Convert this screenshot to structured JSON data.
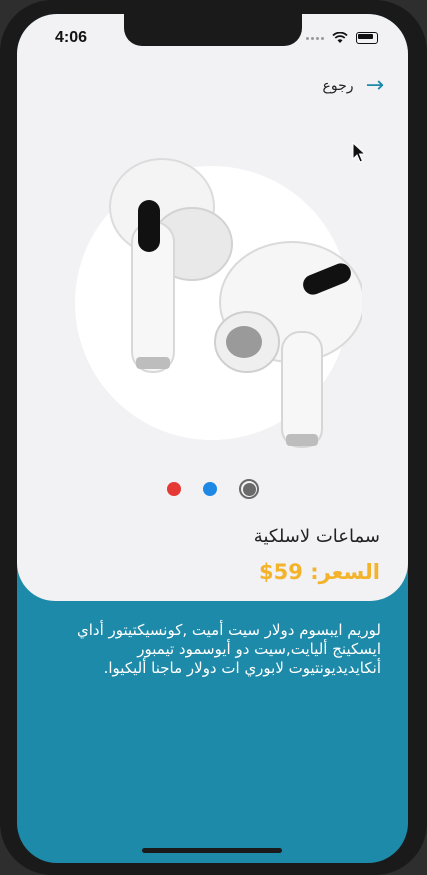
{
  "status_bar": {
    "time": "4:06"
  },
  "header": {
    "back_label": "رجوع",
    "back_icon": "arrow-right-icon"
  },
  "product": {
    "image": "airpods-pro-earbuds",
    "name": "سماعات لاسلكية",
    "price": "السعر: 59$",
    "description": "لوريم ايبسوم دولار سيت أميت ,كونسيكتيتور أداي ايسكينج أليايت,سيت دو أيوسمود تيمبور أنكايديديونتيوت لابوري ات دولار ماجنا أليكيوا."
  },
  "pager": {
    "dots": [
      {
        "color": "#e53935"
      },
      {
        "color": "#1e88e5"
      },
      {
        "color": "#6a6a6a",
        "active": true
      }
    ]
  },
  "colors": {
    "accent": "#1c8aa8",
    "price": "#f3b32a",
    "card": "#f2f1f3"
  }
}
